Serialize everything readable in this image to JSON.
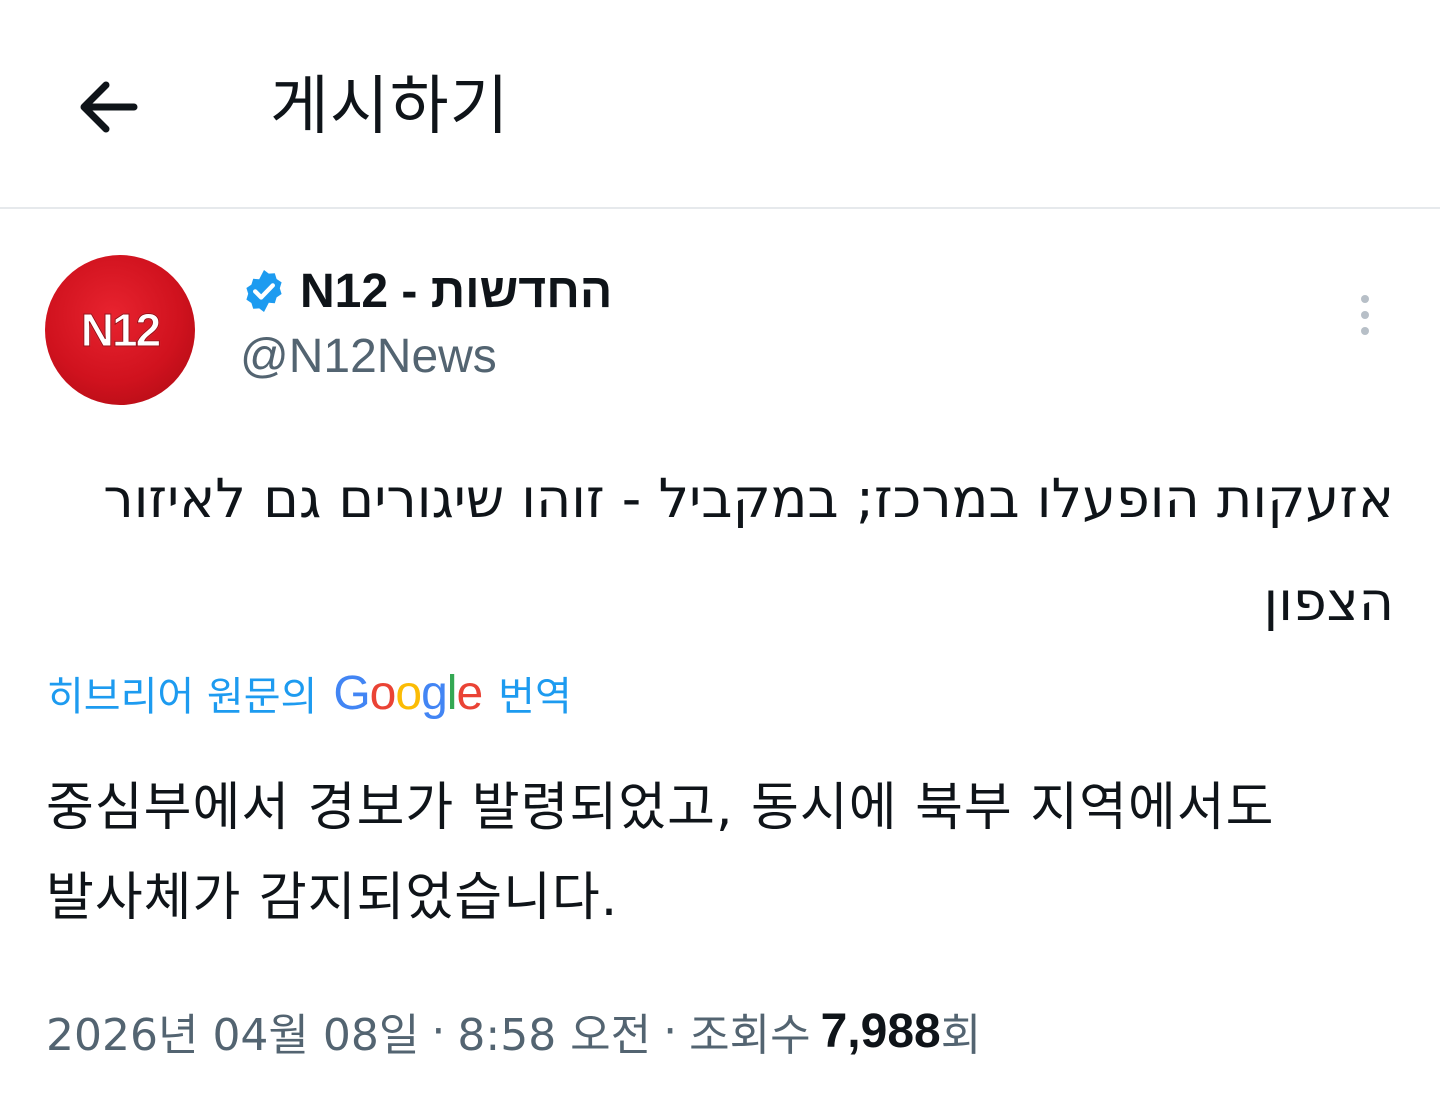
{
  "header": {
    "back_icon": "arrow-left-icon",
    "title": "게시하기"
  },
  "post": {
    "avatar_text": "N12",
    "avatar_color": "#d0121e",
    "display_name": "החדשות - N12",
    "verified_icon": "verified-badge-icon",
    "verified_color": "#1d9bf0",
    "handle": "@N12News",
    "more_icon": "more-vertical-icon",
    "text_original": "אזעקות הופעלו במרכז; במקביל - זוהו שיגורים גם לאיזור הצפון",
    "translation": {
      "prefix": "히브리어 원문의",
      "provider": "Google",
      "suffix": "번역",
      "link_color": "#1d9bf0"
    },
    "text_translated": "중심부에서 경보가 발령되었고, 동시에 북부 지역에서도 발사체가 감지되었습니다.",
    "meta": {
      "date": "2026년 04월 08일",
      "time": "8:58 오전",
      "views_label": "조회수",
      "views_count": "7,988",
      "views_suffix": "회",
      "separator": "·"
    }
  }
}
